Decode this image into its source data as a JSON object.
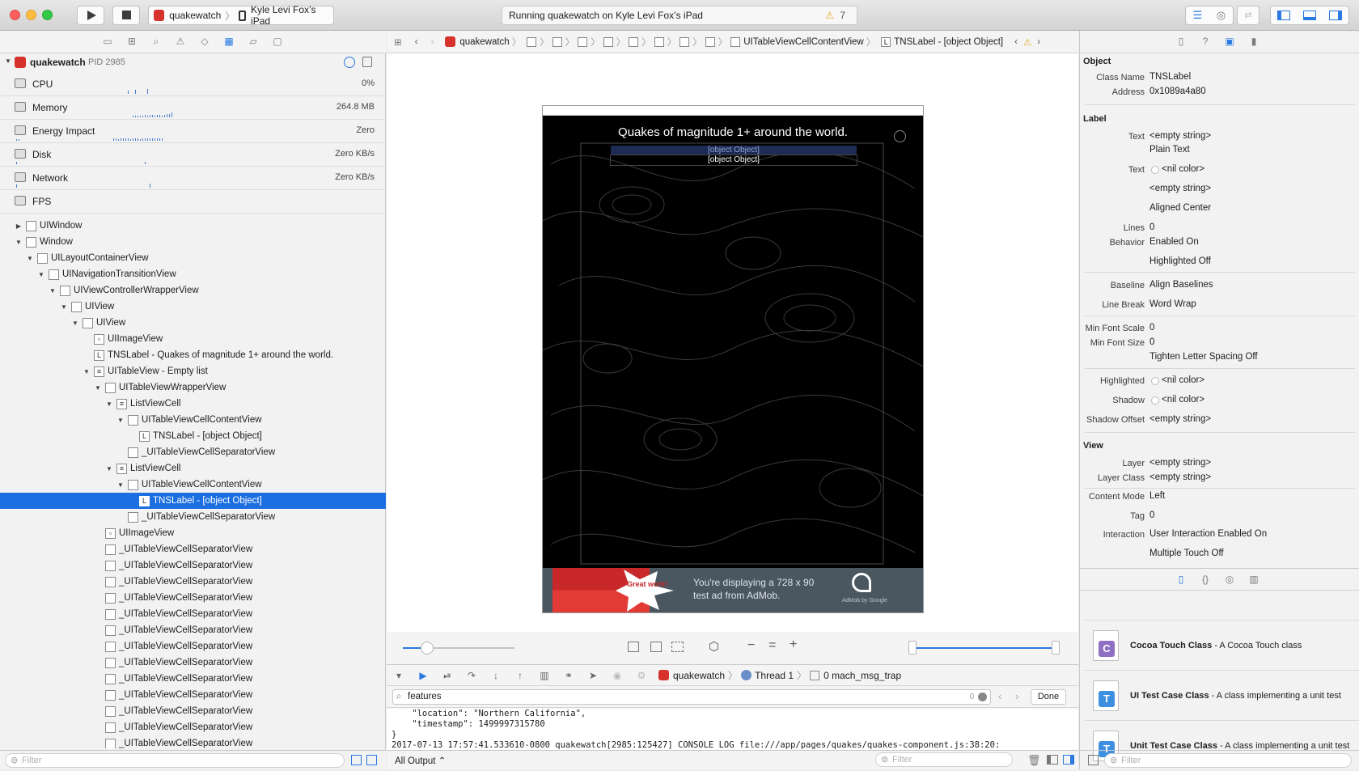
{
  "toolbar": {
    "scheme_app": "quakewatch",
    "scheme_device": "Kyle Levi Fox’s iPad",
    "status_text": "Running quakewatch on Kyle Levi Fox’s iPad",
    "warning_count": "7"
  },
  "debug_nav": {
    "process_name": "quakewatch",
    "process_pid": "PID 2985",
    "gauges": [
      {
        "label": "CPU",
        "value": "0%"
      },
      {
        "label": "Memory",
        "value": "264.8 MB"
      },
      {
        "label": "Energy Impact",
        "value": "Zero"
      },
      {
        "label": "Disk",
        "value": "Zero KB/s"
      },
      {
        "label": "Network",
        "value": "Zero KB/s"
      },
      {
        "label": "FPS",
        "value": ""
      }
    ],
    "tree": [
      {
        "label": "UIWindow",
        "depth": 0,
        "tri": "▶",
        "box": ""
      },
      {
        "label": "Window",
        "depth": 0,
        "tri": "▼",
        "box": ""
      },
      {
        "label": "UILayoutContainerView",
        "depth": 1,
        "tri": "▼",
        "box": ""
      },
      {
        "label": "UINavigationTransitionView",
        "depth": 2,
        "tri": "▼",
        "box": ""
      },
      {
        "label": "UIViewControllerWrapperView",
        "depth": 3,
        "tri": "▼",
        "box": ""
      },
      {
        "label": "UIView",
        "depth": 4,
        "tri": "▼",
        "box": ""
      },
      {
        "label": "UIView",
        "depth": 5,
        "tri": "▼",
        "box": ""
      },
      {
        "label": "UIImageView",
        "depth": 6,
        "tri": "",
        "box": "▫"
      },
      {
        "label": "TNSLabel - Quakes of magnitude 1+ around the world.",
        "depth": 6,
        "tri": "",
        "box": "L"
      },
      {
        "label": "UITableView - Empty list",
        "depth": 6,
        "tri": "▼",
        "box": "≡"
      },
      {
        "label": "UITableViewWrapperView",
        "depth": 7,
        "tri": "▼",
        "box": ""
      },
      {
        "label": "ListViewCell",
        "depth": 8,
        "tri": "▼",
        "box": "≡"
      },
      {
        "label": "UITableViewCellContentView",
        "depth": 9,
        "tri": "▼",
        "box": ""
      },
      {
        "label": "TNSLabel - [object Object]",
        "depth": 10,
        "tri": "",
        "box": "L"
      },
      {
        "label": "_UITableViewCellSeparatorView",
        "depth": 9,
        "tri": "",
        "box": ""
      },
      {
        "label": "ListViewCell",
        "depth": 8,
        "tri": "▼",
        "box": "≡"
      },
      {
        "label": "UITableViewCellContentView",
        "depth": 9,
        "tri": "▼",
        "box": ""
      },
      {
        "label": "TNSLabel - [object Object]",
        "depth": 10,
        "tri": "",
        "box": "L",
        "selected": true
      },
      {
        "label": "_UITableViewCellSeparatorView",
        "depth": 9,
        "tri": "",
        "box": ""
      },
      {
        "label": "UIImageView",
        "depth": 7,
        "tri": "",
        "box": "▫"
      },
      {
        "label": "_UITableViewCellSeparatorView",
        "depth": 7,
        "tri": "",
        "box": ""
      },
      {
        "label": "_UITableViewCellSeparatorView",
        "depth": 7,
        "tri": "",
        "box": ""
      },
      {
        "label": "_UITableViewCellSeparatorView",
        "depth": 7,
        "tri": "",
        "box": ""
      },
      {
        "label": "_UITableViewCellSeparatorView",
        "depth": 7,
        "tri": "",
        "box": ""
      },
      {
        "label": "_UITableViewCellSeparatorView",
        "depth": 7,
        "tri": "",
        "box": ""
      },
      {
        "label": "_UITableViewCellSeparatorView",
        "depth": 7,
        "tri": "",
        "box": ""
      },
      {
        "label": "_UITableViewCellSeparatorView",
        "depth": 7,
        "tri": "",
        "box": ""
      },
      {
        "label": "_UITableViewCellSeparatorView",
        "depth": 7,
        "tri": "",
        "box": ""
      },
      {
        "label": "_UITableViewCellSeparatorView",
        "depth": 7,
        "tri": "",
        "box": ""
      },
      {
        "label": "_UITableViewCellSeparatorView",
        "depth": 7,
        "tri": "",
        "box": ""
      },
      {
        "label": "_UITableViewCellSeparatorView",
        "depth": 7,
        "tri": "",
        "box": ""
      },
      {
        "label": "_UITableViewCellSeparatorView",
        "depth": 7,
        "tri": "",
        "box": ""
      },
      {
        "label": "_UITableViewCellSeparatorView",
        "depth": 7,
        "tri": "",
        "box": ""
      }
    ],
    "filter_placeholder": "Filter"
  },
  "jumpbar": {
    "app": "quakewatch",
    "content_view": "UITableViewCellContentView",
    "label": "TNSLabel - [object Object]"
  },
  "device": {
    "title": "Quakes of magnitude 1+ around the world.",
    "cell1": "[object Object]",
    "cell2": "[object Object]",
    "ad_badge": "Great work!",
    "ad_text_1": "You're displaying a 728 x 90",
    "ad_text_2": "test ad from AdMob.",
    "ad_brand": "AdMob by Google"
  },
  "debug_bar": {
    "app": "quakewatch",
    "thread": "Thread 1",
    "frame": "0 mach_msg_trap"
  },
  "console": {
    "search_value": "features",
    "search_count": "0",
    "done_label": "Done",
    "lines": [
      "    \"location\": \"Northern California\",",
      "    \"timestamp\": 1499997315780",
      "}",
      "2017-07-13 17:57:41.533610-0800 quakewatch[2985:125427] CONSOLE LOG file:///app/pages/quakes/quakes-component.js:38:20:"
    ],
    "output_selector": "All Output ⌃",
    "filter_placeholder": "Filter"
  },
  "inspector": {
    "object_section": "Object",
    "class_name_key": "Class Name",
    "class_name": "TNSLabel",
    "address_key": "Address",
    "address": "0x1089a4a80",
    "label_section": "Label",
    "text_key": "Text",
    "text_value": "<empty string>",
    "text_type": "Plain Text",
    "color_key": "Text",
    "color_value": "<nil color>",
    "font_value": "<empty string>",
    "alignment": "Aligned Center",
    "lines_key": "Lines",
    "lines": "0",
    "behavior_key": "Behavior",
    "behavior_enabled": "Enabled On",
    "behavior_highlighted": "Highlighted Off",
    "baseline_key": "Baseline",
    "baseline": "Align Baselines",
    "line_break_key": "Line Break",
    "line_break": "Word Wrap",
    "min_font_scale_key": "Min Font Scale",
    "min_font_scale": "0",
    "min_font_size_key": "Min Font Size",
    "min_font_size": "0",
    "tighten": "Tighten Letter Spacing Off",
    "highlighted_key": "Highlighted",
    "highlighted": "<nil color>",
    "shadow_key": "Shadow",
    "shadow": "<nil color>",
    "shadow_offset_key": "Shadow Offset",
    "shadow_offset": "<empty string>",
    "view_section": "View",
    "layer_key": "Layer",
    "layer": "<empty string>",
    "layer_class_key": "Layer Class",
    "layer_class": "<empty string>",
    "content_mode_key": "Content Mode",
    "content_mode": "Left",
    "tag_key": "Tag",
    "tag": "0",
    "interaction_key": "Interaction",
    "interaction_1": "User Interaction Enabled On",
    "interaction_2": "Multiple Touch Off"
  },
  "templates": [
    {
      "icon": "C",
      "color": "#8e6fc1",
      "title": "Cocoa Touch Class",
      "desc": " - A Cocoa Touch class"
    },
    {
      "icon": "T",
      "color": "#3d8fe0",
      "title": "UI Test Case Class",
      "desc": " - A class implementing a unit test"
    },
    {
      "icon": "T",
      "color": "#3d8fe0",
      "title": "Unit Test Case Class",
      "desc": " - A class implementing a unit test"
    }
  ],
  "colors": {
    "selection": "#1c6fe0",
    "accent": "#2a7ae2",
    "close": "#fc605c",
    "minimize": "#fdbc40",
    "zoom": "#34c84a"
  }
}
